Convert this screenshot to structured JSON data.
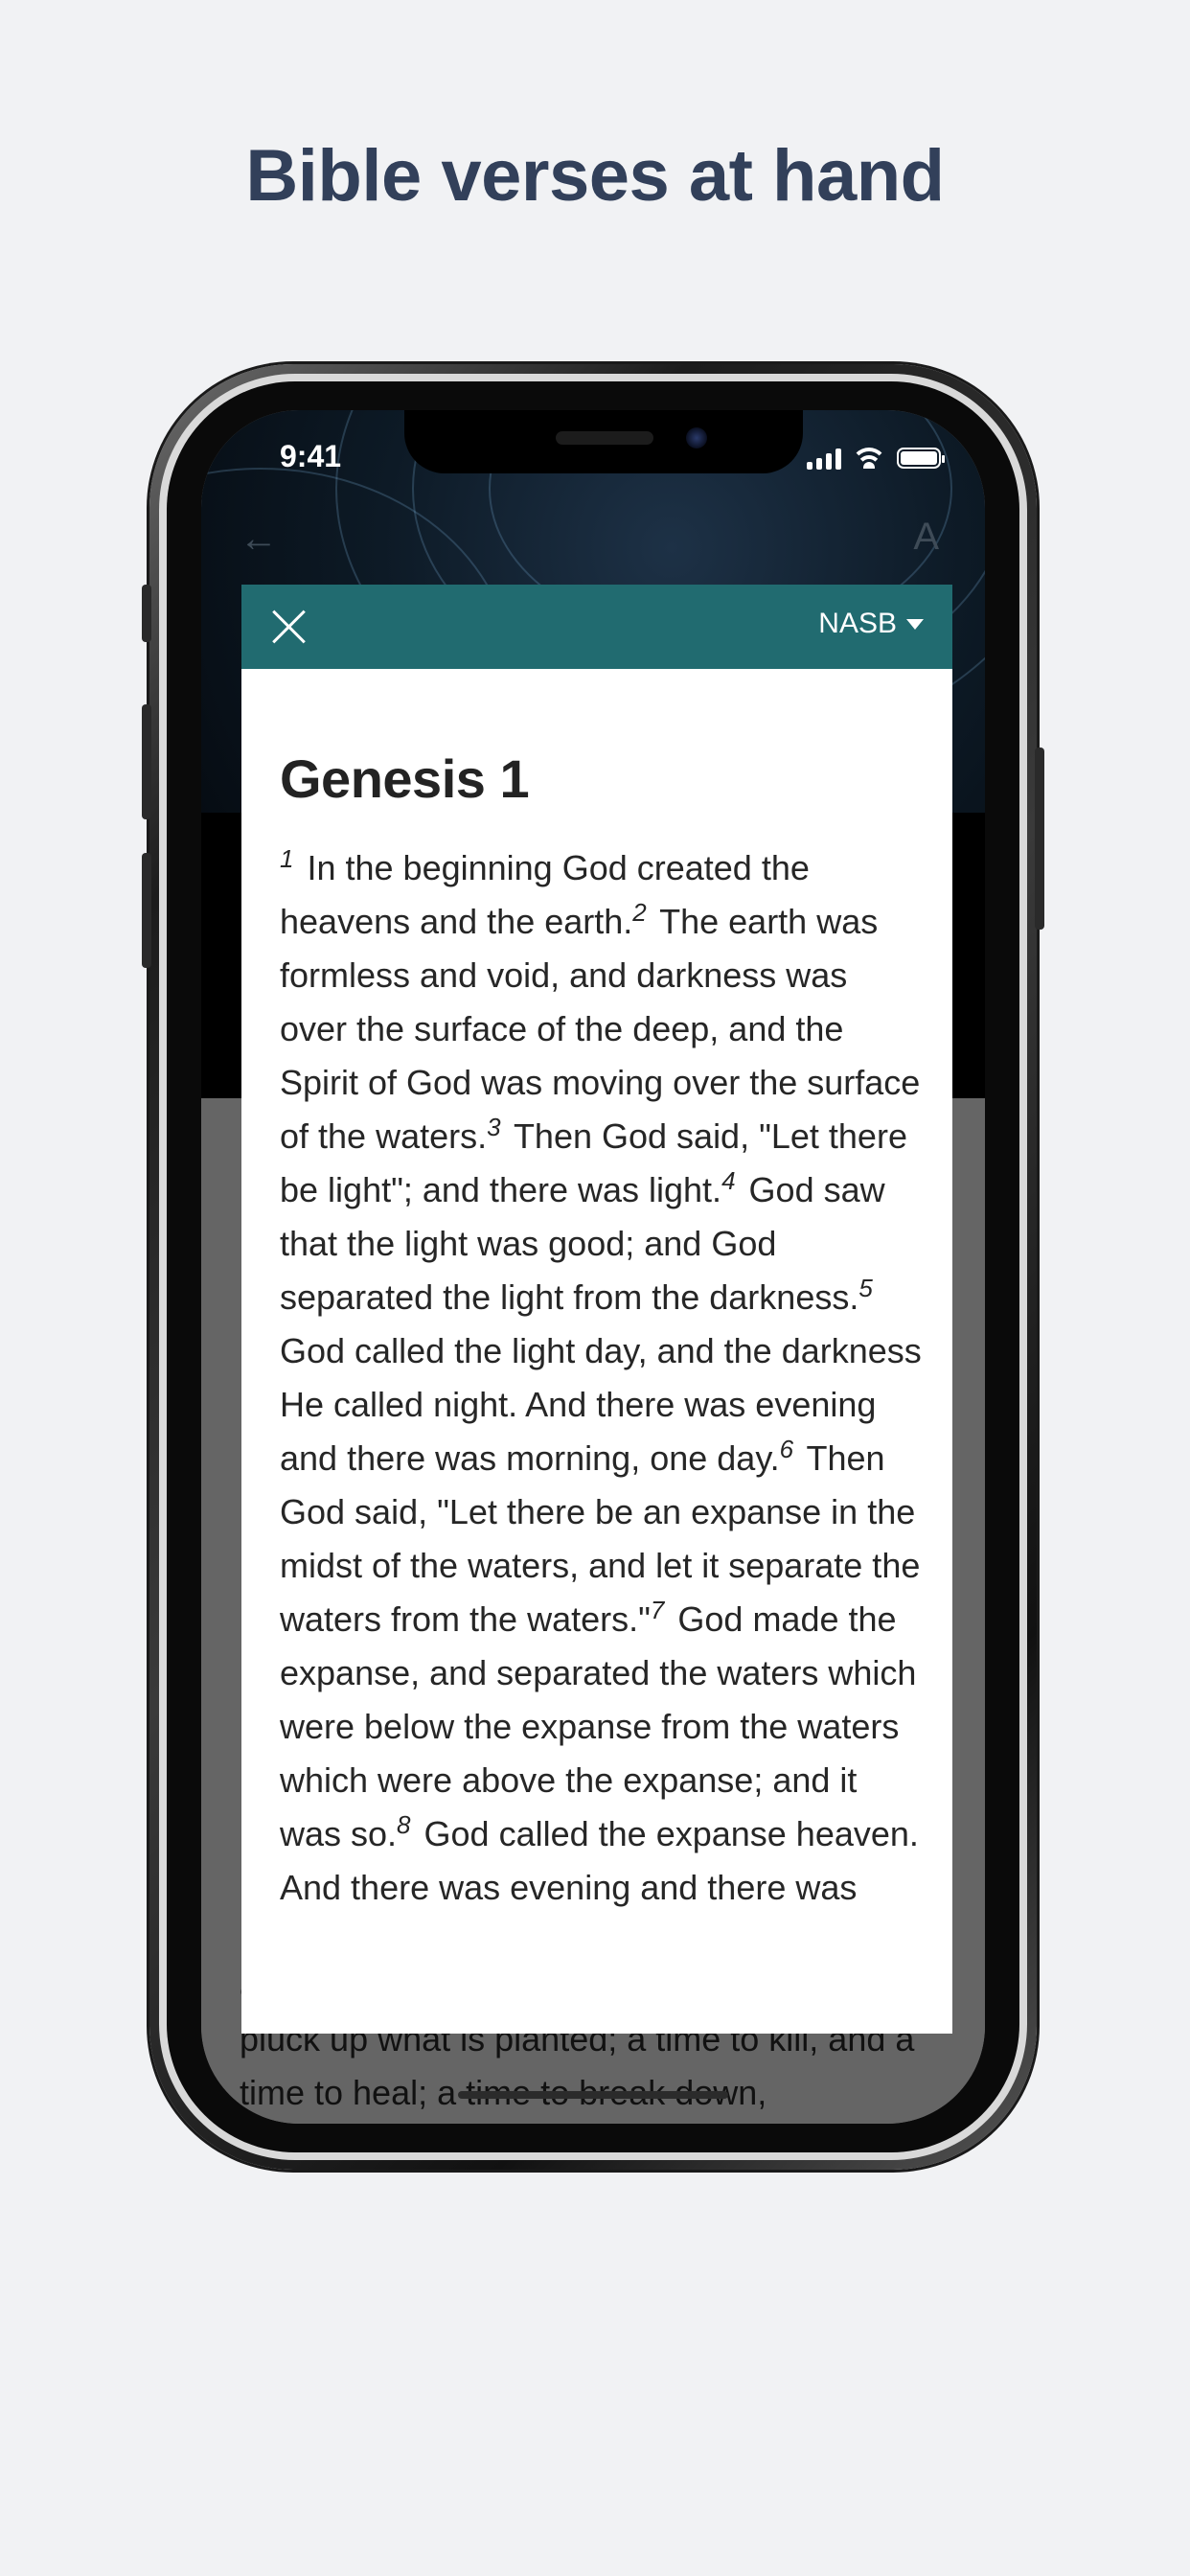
{
  "headline": "Bible verses at hand",
  "status_bar": {
    "time": "9:41",
    "icons": [
      "signal-icon",
      "wifi-icon",
      "battery-icon"
    ]
  },
  "app_background": {
    "back_icon": "back-arrow-icon",
    "font_icon": "font-size-icon",
    "visible_text": "and a time to die; a time to plant, and a time to pluck up what is planted; a time to kill, and a time to heal; a time to break down,"
  },
  "modal": {
    "close_icon": "close-icon",
    "version_label": "NASB",
    "chapter_title": "Genesis 1",
    "verses": [
      {
        "num": "1",
        "text": "In the beginning God created the heavens and the earth."
      },
      {
        "num": "2",
        "text": "The earth was formless and void, and darkness was over the surface of the deep, and the Spirit of God was moving over the surface of the waters."
      },
      {
        "num": "3",
        "text": "Then God said, \"Let there be light\"; and there was light."
      },
      {
        "num": "4",
        "text": "God saw that the light was good; and God separated the light from the darkness."
      },
      {
        "num": "5",
        "text": "God called the light day, and the darkness He called night. And there was evening and there was morning, one day."
      },
      {
        "num": "6",
        "text": "Then God said, \"Let there be an expanse in the midst of the waters, and let it separate the waters from the waters.\""
      },
      {
        "num": "7",
        "text": "God made the expanse, and separated the waters which were below the expanse from the waters which were above the expanse; and it was so."
      },
      {
        "num": "8",
        "text": "God called the expanse heaven. And there was evening and there was"
      }
    ]
  },
  "colors": {
    "page_background": "#f1f2f4",
    "headline": "#32405a",
    "modal_header": "#216b70",
    "overlay": "#656565"
  }
}
